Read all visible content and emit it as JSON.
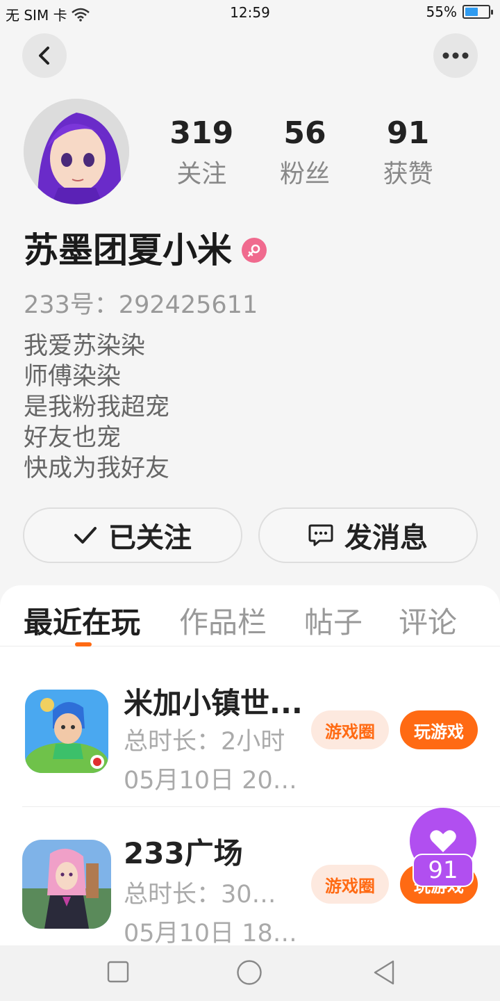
{
  "status_bar": {
    "carrier": "无 SIM 卡",
    "time": "12:59",
    "battery_pct": "55%",
    "battery_level": 0.55
  },
  "nav": {
    "back_icon": "chevron-left-icon",
    "more_icon": "more-dots-icon"
  },
  "profile": {
    "name": "苏墨团夏小米",
    "gender_icon": "female-icon",
    "uid": "233号：292425611",
    "bio": [
      "我爱苏染染",
      "师傅染染",
      "是我粉我超宠",
      "好友也宠",
      "快成为我好友"
    ],
    "stats": [
      {
        "value": "319",
        "label": "关注"
      },
      {
        "value": "56",
        "label": "粉丝"
      },
      {
        "value": "91",
        "label": "获赞"
      }
    ]
  },
  "actions": {
    "follow_label": "已关注",
    "message_label": "发消息"
  },
  "tabs": [
    "最近在玩",
    "作品栏",
    "帖子",
    "评论"
  ],
  "games": [
    {
      "title": "米加小镇世...",
      "duration": "总时长：2小时",
      "last_played": "05月10日 20:...",
      "circle_label": "游戏圈",
      "play_label": "玩游戏"
    },
    {
      "title": "233广场",
      "duration": "总时长：30分...",
      "last_played": "05月10日 18:...",
      "circle_label": "游戏圈",
      "play_label": "玩游戏"
    }
  ],
  "like_bubble": {
    "count": "91"
  },
  "colors": {
    "accent": "#ff6a13",
    "like_bubble": "#b14ff0",
    "gender": "#f06a8e"
  }
}
